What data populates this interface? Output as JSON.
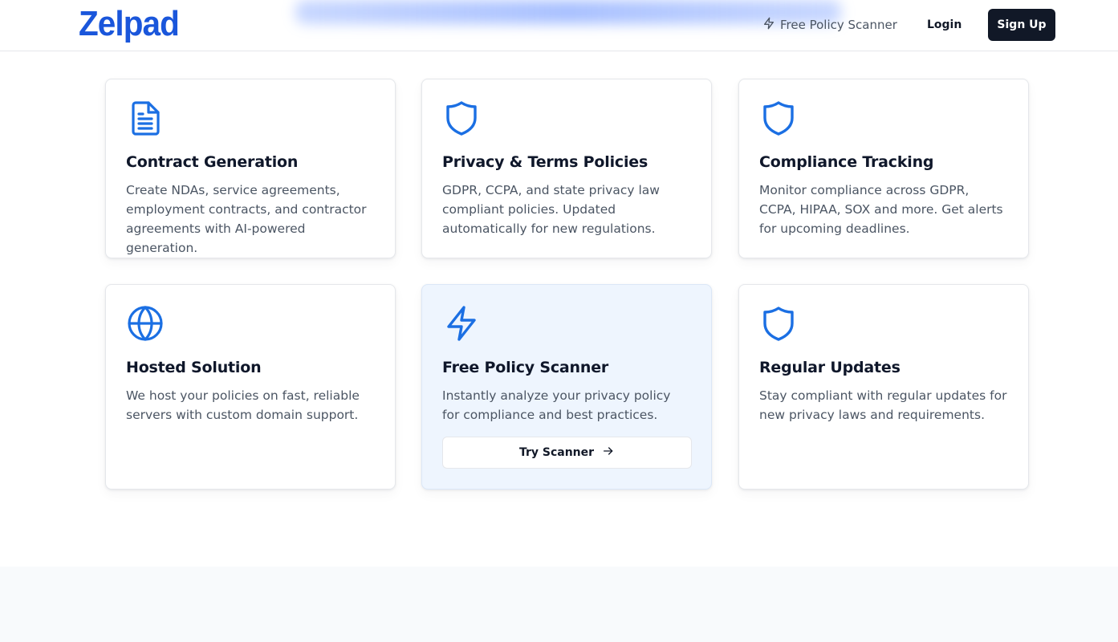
{
  "header": {
    "logo": "Zelpad",
    "nav_scanner_label": "Free Policy Scanner",
    "login_label": "Login",
    "signup_label": "Sign Up"
  },
  "features": [
    {
      "icon": "document-icon",
      "title": "Contract Generation",
      "description": "Create NDAs, service agreements, employment contracts, and contractor agreements with AI-powered generation."
    },
    {
      "icon": "shield-icon",
      "title": "Privacy & Terms Policies",
      "description": "GDPR, CCPA, and state privacy law compliant policies. Updated automatically for new regulations."
    },
    {
      "icon": "shield-icon",
      "title": "Compliance Tracking",
      "description": "Monitor compliance across GDPR, CCPA, HIPAA, SOX and more. Get alerts for upcoming deadlines."
    },
    {
      "icon": "globe-icon",
      "title": "Hosted Solution",
      "description": "We host your policies on fast, reliable servers with custom domain support."
    },
    {
      "icon": "lightning-icon",
      "title": "Free Policy Scanner",
      "description": "Instantly analyze your privacy policy for compliance and best practices.",
      "button_label": "Try Scanner"
    },
    {
      "icon": "shield-icon",
      "title": "Regular Updates",
      "description": "Stay compliant with regular updates for new privacy laws and requirements."
    }
  ],
  "colors": {
    "brand": "#1a56db",
    "icon_blue": "#1b6fe3",
    "dark_button": "#111827",
    "highlight_card": "#eef5fe"
  }
}
